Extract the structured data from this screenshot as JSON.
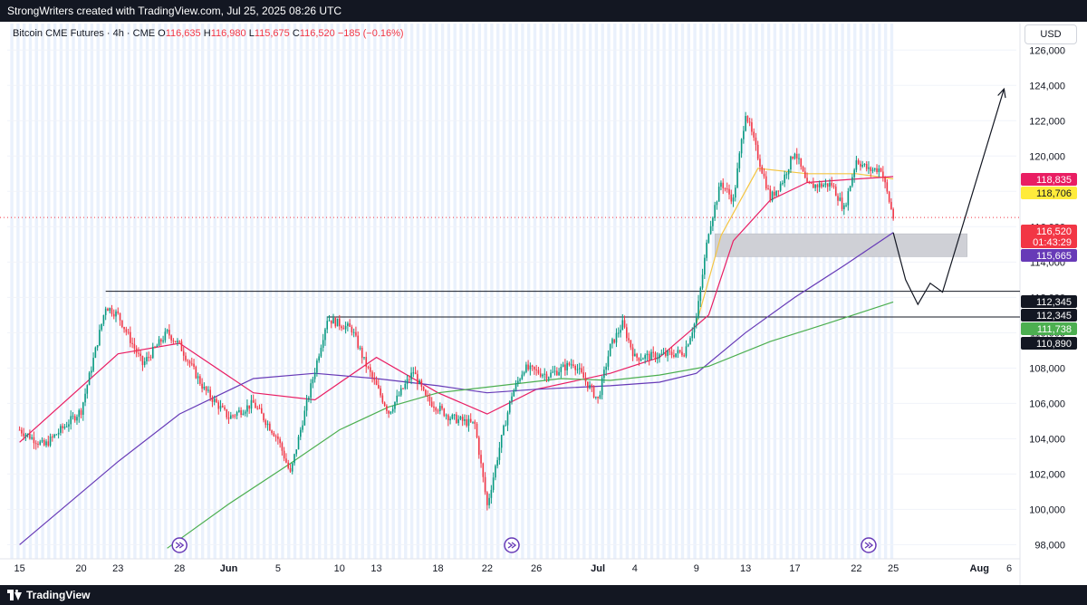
{
  "header": {
    "attribution": "StrongWriters created with TradingView.com, Jul 25, 2025 08:26 UTC"
  },
  "footer": {
    "brand": "TradingView"
  },
  "legend": {
    "symbol": "Bitcoin CME Futures · 4h · CME",
    "o_label": "O",
    "o_value": "116,635",
    "h_label": "H",
    "h_value": "116,980",
    "l_label": "L",
    "l_value": "115,675",
    "c_label": "C",
    "c_value": "116,520",
    "change": "−185 (−0.16%)"
  },
  "currency": "USD",
  "colors": {
    "up": "#089981",
    "down": "#f23645",
    "ma_fast": "#f5c542",
    "ma_mid": "#e91e63",
    "ma_slow": "#673ab7",
    "ma_long": "#4caf50",
    "session_band": "#eaf1fc"
  },
  "chart_data": {
    "type": "candlestick",
    "interval": "4h",
    "symbol": "Bitcoin CME Futures",
    "exchange": "CME",
    "ohlc_last": {
      "open": 116635,
      "high": 116980,
      "low": 115675,
      "close": 116520,
      "change": -185,
      "change_pct": -0.16
    },
    "y_axis": {
      "ticks": [
        "98,000",
        "100,000",
        "102,000",
        "104,000",
        "106,000",
        "108,000",
        "110,000",
        "112,000",
        "114,000",
        "116,000",
        "118,000",
        "120,000",
        "122,000",
        "124,000",
        "126,000"
      ],
      "range": [
        97200,
        127500
      ]
    },
    "x_axis": {
      "ticks": [
        "15",
        "20",
        "23",
        "28",
        "Jun",
        "5",
        "10",
        "13",
        "18",
        "22",
        "26",
        "Jul",
        "4",
        "9",
        "13",
        "17",
        "22",
        "25",
        "Aug",
        "6"
      ]
    },
    "price_path": [
      {
        "date": "May 15",
        "price": 104500
      },
      {
        "date": "May 17",
        "price": 103600
      },
      {
        "date": "May 20",
        "price": 105600
      },
      {
        "date": "May 21",
        "price": 108500
      },
      {
        "date": "May 22",
        "price": 111500
      },
      {
        "date": "May 23",
        "price": 111000
      },
      {
        "date": "May 25",
        "price": 108200
      },
      {
        "date": "May 27",
        "price": 110000
      },
      {
        "date": "May 28",
        "price": 109300
      },
      {
        "date": "May 30",
        "price": 106800
      },
      {
        "date": "Jun 1",
        "price": 105200
      },
      {
        "date": "Jun 3",
        "price": 106000
      },
      {
        "date": "Jun 5",
        "price": 104000
      },
      {
        "date": "Jun 6",
        "price": 102000
      },
      {
        "date": "Jun 7",
        "price": 105000
      },
      {
        "date": "Jun 9",
        "price": 110800
      },
      {
        "date": "Jun 11",
        "price": 110200
      },
      {
        "date": "Jun 12",
        "price": 108400
      },
      {
        "date": "Jun 14",
        "price": 105500
      },
      {
        "date": "Jun 16",
        "price": 107800
      },
      {
        "date": "Jun 17",
        "price": 106300
      },
      {
        "date": "Jun 19",
        "price": 105200
      },
      {
        "date": "Jun 21",
        "price": 104800
      },
      {
        "date": "Jun 22",
        "price": 100200
      },
      {
        "date": "Jun 23",
        "price": 103500
      },
      {
        "date": "Jun 24",
        "price": 106500
      },
      {
        "date": "Jun 25",
        "price": 108000
      },
      {
        "date": "Jun 27",
        "price": 107600
      },
      {
        "date": "Jun 29",
        "price": 108300
      },
      {
        "date": "Jul 1",
        "price": 106200
      },
      {
        "date": "Jul 2",
        "price": 109200
      },
      {
        "date": "Jul 3",
        "price": 110500
      },
      {
        "date": "Jul 4",
        "price": 108600
      },
      {
        "date": "Jul 6",
        "price": 108700
      },
      {
        "date": "Jul 8",
        "price": 108900
      },
      {
        "date": "Jul 9",
        "price": 110800
      },
      {
        "date": "Jul 10",
        "price": 115800
      },
      {
        "date": "Jul 11",
        "price": 118500
      },
      {
        "date": "Jul 12",
        "price": 117500
      },
      {
        "date": "Jul 13",
        "price": 122500
      },
      {
        "date": "Jul 14",
        "price": 120000
      },
      {
        "date": "Jul 15",
        "price": 117600
      },
      {
        "date": "Jul 16",
        "price": 118600
      },
      {
        "date": "Jul 17",
        "price": 120300
      },
      {
        "date": "Jul 18",
        "price": 118300
      },
      {
        "date": "Jul 20",
        "price": 118400
      },
      {
        "date": "Jul 21",
        "price": 117000
      },
      {
        "date": "Jul 22",
        "price": 119800
      },
      {
        "date": "Jul 23",
        "price": 119200
      },
      {
        "date": "Jul 24",
        "price": 119300
      },
      {
        "date": "Jul 25",
        "price": 116520
      }
    ],
    "moving_averages": [
      {
        "name": "fast",
        "color": "#f5c542",
        "last": 118706,
        "points": [
          {
            "date": "Jul 9",
            "price": 110500
          },
          {
            "date": "Jul 11",
            "price": 115500
          },
          {
            "date": "Jul 14",
            "price": 119300
          },
          {
            "date": "Jul 18",
            "price": 119000
          },
          {
            "date": "Jul 22",
            "price": 119000
          },
          {
            "date": "Jul 25",
            "price": 118706
          }
        ]
      },
      {
        "name": "mid",
        "color": "#e91e63",
        "last": 118835,
        "points": [
          {
            "date": "May 15",
            "price": 103800
          },
          {
            "date": "May 23",
            "price": 108800
          },
          {
            "date": "May 28",
            "price": 109400
          },
          {
            "date": "Jun 3",
            "price": 106600
          },
          {
            "date": "Jun 8",
            "price": 106200
          },
          {
            "date": "Jun 13",
            "price": 108600
          },
          {
            "date": "Jun 18",
            "price": 106600
          },
          {
            "date": "Jun 22",
            "price": 105400
          },
          {
            "date": "Jun 26",
            "price": 106800
          },
          {
            "date": "Jul 2",
            "price": 107700
          },
          {
            "date": "Jul 6",
            "price": 108600
          },
          {
            "date": "Jul 10",
            "price": 111000
          },
          {
            "date": "Jul 12",
            "price": 115200
          },
          {
            "date": "Jul 15",
            "price": 117500
          },
          {
            "date": "Jul 18",
            "price": 118500
          },
          {
            "date": "Jul 22",
            "price": 118700
          },
          {
            "date": "Jul 25",
            "price": 118835
          }
        ]
      },
      {
        "name": "slow",
        "color": "#673ab7",
        "last": 115665,
        "points": [
          {
            "date": "May 15",
            "price": 98000
          },
          {
            "date": "May 23",
            "price": 102700
          },
          {
            "date": "May 28",
            "price": 105400
          },
          {
            "date": "Jun 3",
            "price": 107400
          },
          {
            "date": "Jun 8",
            "price": 107700
          },
          {
            "date": "Jun 13",
            "price": 107400
          },
          {
            "date": "Jun 18",
            "price": 107000
          },
          {
            "date": "Jun 22",
            "price": 106600
          },
          {
            "date": "Jun 26",
            "price": 106800
          },
          {
            "date": "Jul 2",
            "price": 107000
          },
          {
            "date": "Jul 6",
            "price": 107200
          },
          {
            "date": "Jul 9",
            "price": 107700
          },
          {
            "date": "Jul 13",
            "price": 110000
          },
          {
            "date": "Jul 17",
            "price": 112000
          },
          {
            "date": "Jul 21",
            "price": 113800
          },
          {
            "date": "Jul 25",
            "price": 115665
          }
        ]
      },
      {
        "name": "long",
        "color": "#4caf50",
        "last": 111738,
        "points": [
          {
            "date": "May 27",
            "price": 97800
          },
          {
            "date": "Jun 1",
            "price": 100300
          },
          {
            "date": "Jun 6",
            "price": 102600
          },
          {
            "date": "Jun 10",
            "price": 104500
          },
          {
            "date": "Jun 14",
            "price": 105800
          },
          {
            "date": "Jun 18",
            "price": 106600
          },
          {
            "date": "Jun 23",
            "price": 107000
          },
          {
            "date": "Jun 28",
            "price": 107400
          },
          {
            "date": "Jul 2",
            "price": 107300
          },
          {
            "date": "Jul 6",
            "price": 107600
          },
          {
            "date": "Jul 10",
            "price": 108100
          },
          {
            "date": "Jul 15",
            "price": 109500
          },
          {
            "date": "Jul 20",
            "price": 110600
          },
          {
            "date": "Jul 25",
            "price": 111738
          }
        ]
      }
    ],
    "price_labels": [
      {
        "value": "118,835",
        "bg": "#e91e63",
        "fg": "#ffffff"
      },
      {
        "value": "118,706",
        "bg": "#ffeb3b",
        "fg": "#131722"
      },
      {
        "value": "116,520",
        "bg": "#f23645",
        "fg": "#ffffff",
        "countdown": "01:43:29"
      },
      {
        "value": "115,665",
        "bg": "#673ab7",
        "fg": "#ffffff"
      },
      {
        "value": "112,345",
        "bg": "#131722",
        "fg": "#ffffff"
      },
      {
        "value": "112,345",
        "bg": "#131722",
        "fg": "#ffffff"
      },
      {
        "value": "111,738",
        "bg": "#4caf50",
        "fg": "#ffffff"
      },
      {
        "value": "110,890",
        "bg": "#131722",
        "fg": "#ffffff"
      }
    ],
    "horizontal_levels": [
      {
        "price": 112345,
        "from": "May 22"
      },
      {
        "price": 110890,
        "from": "Jun 9"
      }
    ],
    "zone": {
      "from": "Jul 10",
      "to": "Jul 31",
      "low": 114300,
      "high": 115600
    },
    "projection_path": [
      {
        "date": "Jul 25",
        "price": 115665
      },
      {
        "date": "Jul 26",
        "price": 113000
      },
      {
        "date": "Jul 27",
        "price": 111600
      },
      {
        "date": "Jul 28",
        "price": 112800
      },
      {
        "date": "Jul 29",
        "price": 112300
      },
      {
        "date": "Aug 3",
        "price": 123800
      }
    ],
    "session_markers": [
      "May 28",
      "Jun 24",
      "Jul 23"
    ]
  }
}
